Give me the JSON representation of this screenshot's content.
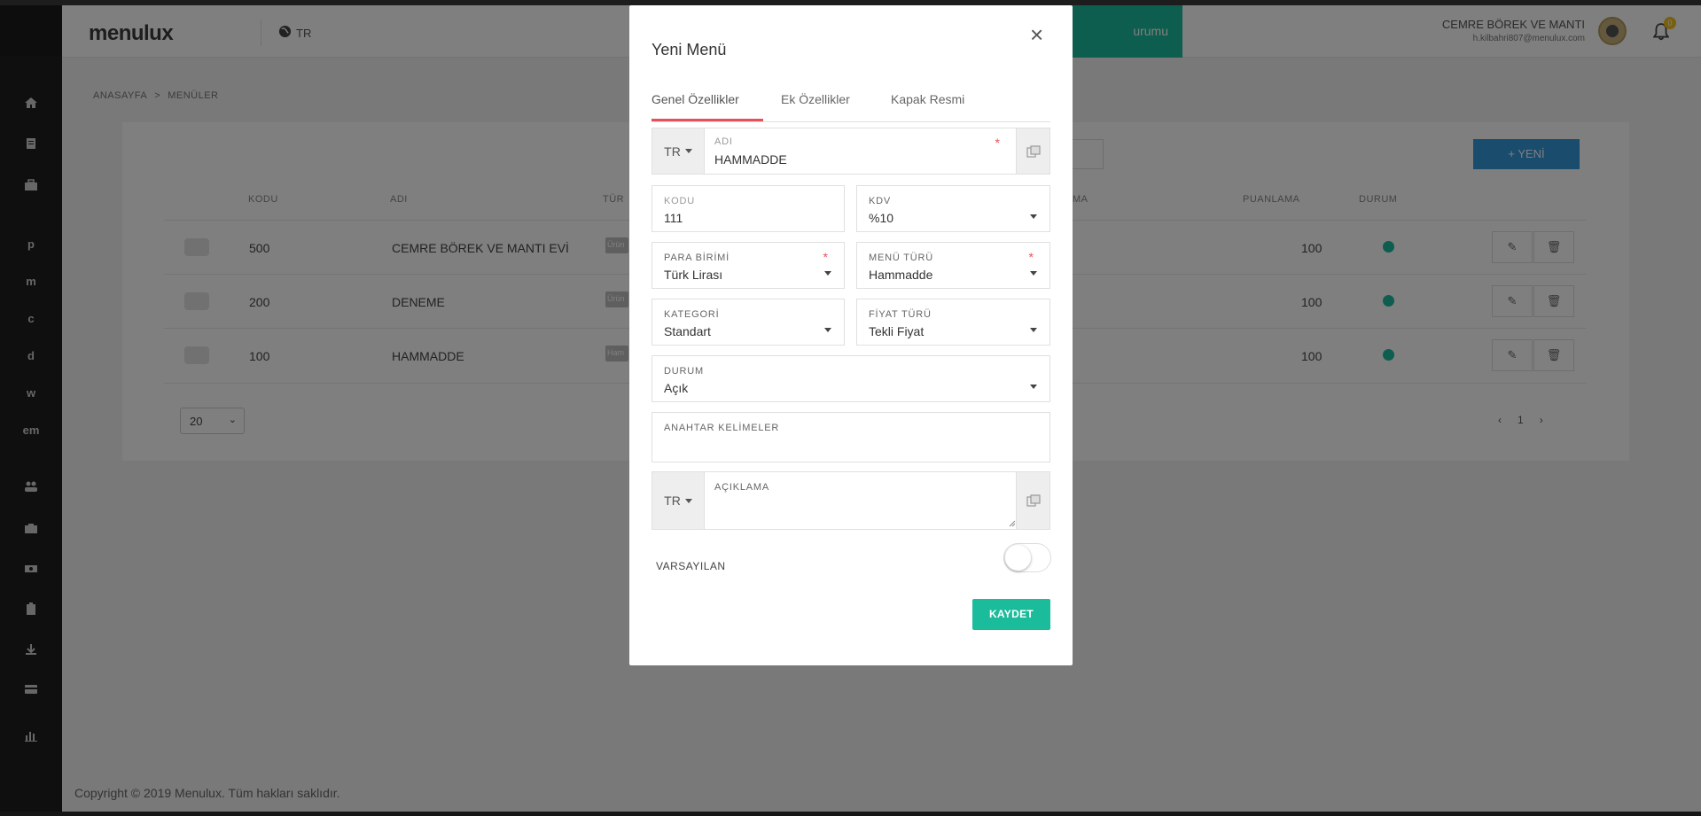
{
  "app": {
    "brand": "menulux",
    "lang": "TR",
    "top_button_label": "urumu",
    "user_name": "CEMRE BÖREK VE MANTI",
    "user_email": "h.kilbahri807@menulux.com",
    "notification_count": "0"
  },
  "sidebar": {
    "letters": [
      "p",
      "m",
      "c",
      "d",
      "w",
      "em"
    ]
  },
  "breadcrumb": {
    "home": "ANASAYFA",
    "separator": ">",
    "current": "MENÜLER"
  },
  "table": {
    "new_button": "+ YENİ",
    "headers": [
      "KODU",
      "ADI",
      "TÜR",
      "MA",
      "PUANLAMA",
      "DURUM"
    ],
    "rows": [
      {
        "code": "500",
        "name": "CEMRE BÖREK VE MANTI EVİ",
        "type": "Ürün",
        "score": "100"
      },
      {
        "code": "200",
        "name": "DENEME",
        "type": "Ürün",
        "score": "100"
      },
      {
        "code": "100",
        "name": "HAMMADDE",
        "type": "Ham",
        "score": "100"
      }
    ],
    "page_size": "20",
    "current_page": "1"
  },
  "footer": {
    "text": "Copyright © 2019 Menulux. Tüm hakları saklıdır."
  },
  "modal": {
    "title": "Yeni Menü",
    "close": "×",
    "tabs": [
      "Genel Özellikler",
      "Ek Özellikler",
      "Kapak Resmi"
    ],
    "name_lang": "TR",
    "name_label": "ADI",
    "name_value": "HAMMADDE",
    "code_label": "KODU",
    "code_value": "111",
    "kdv_label": "KDV",
    "kdv_value": "%10",
    "currency_label": "PARA BİRİMİ",
    "currency_value": "Türk Lirası",
    "menu_type_label": "MENÜ TÜRÜ",
    "menu_type_value": "Hammadde",
    "category_label": "KATEGORİ",
    "category_value": "Standart",
    "price_type_label": "FİYAT TÜRÜ",
    "price_type_value": "Tekli Fiyat",
    "status_label": "DURUM",
    "status_value": "Açık",
    "keywords_label": "ANAHTAR KELİMELER",
    "keywords_value": "",
    "description_lang": "TR",
    "description_label": "AÇIKLAMA",
    "default_label": "VARSAYILAN",
    "required_mark": "*",
    "save_button": "KAYDET"
  },
  "colors": {
    "accent": "#1bbc9b",
    "tab_underline": "#e7505a",
    "new_button": "#3598dc"
  }
}
